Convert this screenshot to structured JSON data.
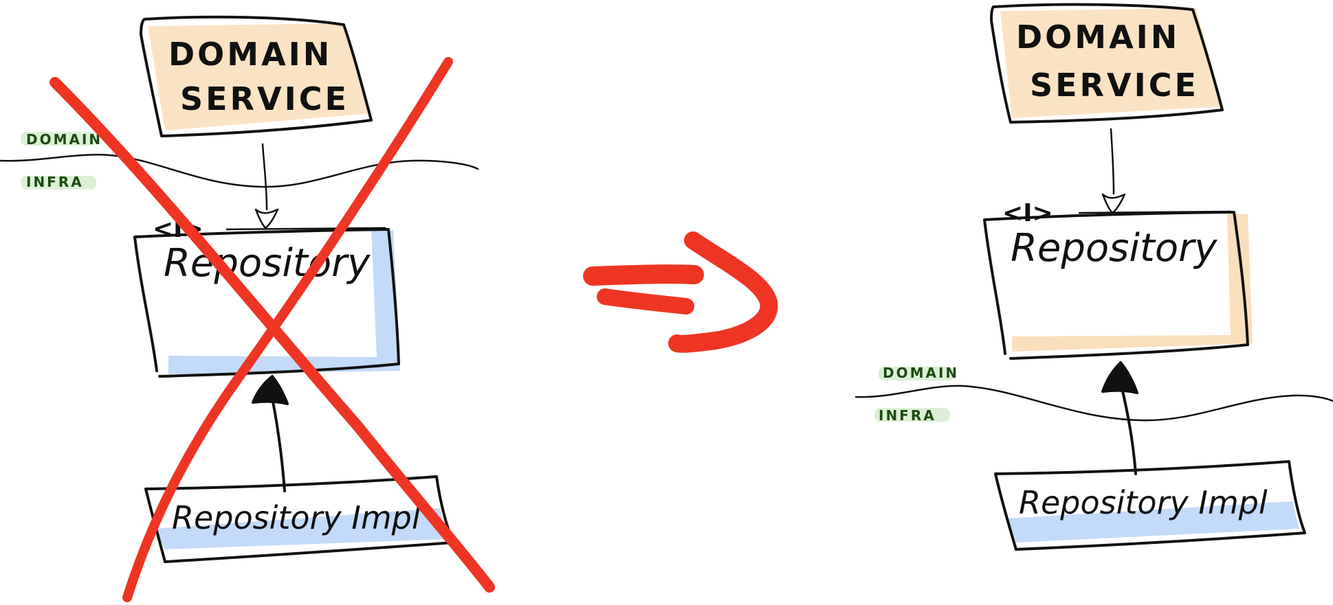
{
  "colors": {
    "ink": "#111111",
    "cross_red": "#ee3524",
    "domain_fill": "#f8d9b0",
    "interface_blue": "#b8d3f7",
    "layer_label_green": "#1d4a12",
    "layer_label_bg": "#cfe8c4"
  },
  "left": {
    "domain_service": {
      "line1": "DOMAIN",
      "line2": "SERVICE"
    },
    "layer_labels": {
      "domain": "DOMAIN",
      "infra": "INFRA"
    },
    "repository": {
      "stereotype": "<I>",
      "label": "Repository"
    },
    "repository_impl": {
      "label": "Repository Impl"
    }
  },
  "right": {
    "domain_service": {
      "line1": "DOMAIN",
      "line2": "SERVICE"
    },
    "layer_labels": {
      "domain": "DOMAIN",
      "infra": "INFRA"
    },
    "repository": {
      "stereotype": "<I>",
      "label": "Repository"
    },
    "repository_impl": {
      "label": "Repository Impl"
    }
  },
  "icons": {
    "cross_out": "x-mark-icon",
    "transition": "implies-arrow-icon"
  }
}
